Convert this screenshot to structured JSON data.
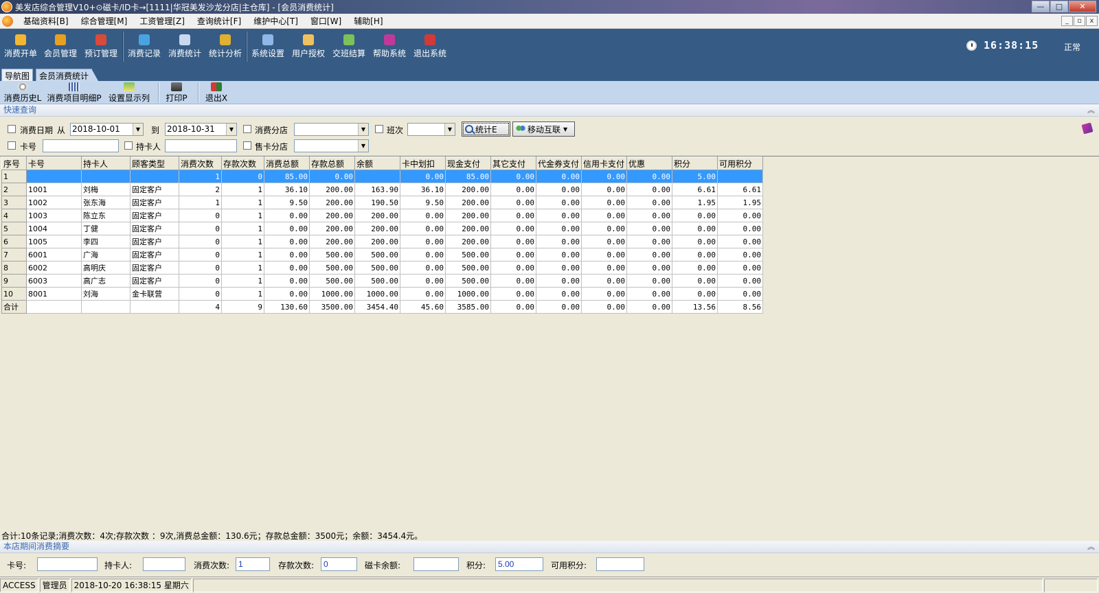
{
  "window": {
    "title": "美发店综合管理V10+⊙磁卡/ID卡→[1111|华冠美发沙龙分店|主仓库] - [会员消费统计]",
    "min_glyph": "—",
    "max_glyph": "□",
    "close_glyph": "✕"
  },
  "menu": {
    "items": [
      "基础资料[B]",
      "综合管理[M]",
      "工资管理[Z]",
      "查询统计[F]",
      "维护中心[T]",
      "窗口[W]",
      "辅助[H]"
    ],
    "mdi_min": "_",
    "mdi_restore": "▫",
    "mdi_close": "x"
  },
  "toolbar": {
    "buttons": [
      {
        "label": "消费开单",
        "color": "#f2b632"
      },
      {
        "label": "会员管理",
        "color": "#e8a020"
      },
      {
        "label": "预订管理",
        "color": "#d94a3a"
      },
      {
        "label": "消费记录",
        "color": "#4aa3e0"
      },
      {
        "label": "消费统计",
        "color": "#c8d8f0"
      },
      {
        "label": "统计分析",
        "color": "#e0b030"
      },
      {
        "label": "系统设置",
        "color": "#8fb8e8"
      },
      {
        "label": "用户授权",
        "color": "#f0c060"
      },
      {
        "label": "交班结算",
        "color": "#7cc15a"
      },
      {
        "label": "帮助系统",
        "color": "#c0399a"
      },
      {
        "label": "退出系统",
        "color": "#d23a3a"
      }
    ],
    "clock": "16:38:15",
    "status": "正常"
  },
  "tabs": [
    "导航图",
    "会员消费统计"
  ],
  "subtoolbar": {
    "buttons": [
      "消费历史L",
      "消费项目明细P",
      "设置显示列",
      "打印P",
      "退出X"
    ]
  },
  "quick_query": {
    "header": "快速查询",
    "date_label": "消费日期",
    "from_label": "从",
    "date_from": "2018-10-01",
    "to_label": "到",
    "date_to": "2018-10-31",
    "branch_label": "消费分店",
    "branch_value": "",
    "shift_label": "班次",
    "shift_value": "",
    "stat_button": "统计E",
    "mobile_button": "移动互联",
    "card_label": "卡号",
    "card_value": "",
    "holder_label": "持卡人",
    "holder_value": "",
    "sale_branch_label": "售卡分店",
    "sale_branch_value": ""
  },
  "grid": {
    "columns": [
      "序号",
      "卡号",
      "持卡人",
      "顾客类型",
      "消费次数",
      "存款次数",
      "消费总额",
      "存款总额",
      "余额",
      "卡中划扣",
      "现金支付",
      "其它支付",
      "代金券支付",
      "信用卡支付",
      "优惠",
      "积分",
      "可用积分"
    ],
    "rows": [
      [
        "1",
        "",
        "",
        "",
        "1",
        "0",
        "85.00",
        "0.00",
        "",
        "0.00",
        "85.00",
        "0.00",
        "0.00",
        "0.00",
        "0.00",
        "5.00",
        ""
      ],
      [
        "2",
        "1001",
        "刘梅",
        "固定客户",
        "2",
        "1",
        "36.10",
        "200.00",
        "163.90",
        "36.10",
        "200.00",
        "0.00",
        "0.00",
        "0.00",
        "0.00",
        "6.61",
        "6.61"
      ],
      [
        "3",
        "1002",
        "张东海",
        "固定客户",
        "1",
        "1",
        "9.50",
        "200.00",
        "190.50",
        "9.50",
        "200.00",
        "0.00",
        "0.00",
        "0.00",
        "0.00",
        "1.95",
        "1.95"
      ],
      [
        "4",
        "1003",
        "陈立东",
        "固定客户",
        "0",
        "1",
        "0.00",
        "200.00",
        "200.00",
        "0.00",
        "200.00",
        "0.00",
        "0.00",
        "0.00",
        "0.00",
        "0.00",
        "0.00"
      ],
      [
        "5",
        "1004",
        "丁健",
        "固定客户",
        "0",
        "1",
        "0.00",
        "200.00",
        "200.00",
        "0.00",
        "200.00",
        "0.00",
        "0.00",
        "0.00",
        "0.00",
        "0.00",
        "0.00"
      ],
      [
        "6",
        "1005",
        "李四",
        "固定客户",
        "0",
        "1",
        "0.00",
        "200.00",
        "200.00",
        "0.00",
        "200.00",
        "0.00",
        "0.00",
        "0.00",
        "0.00",
        "0.00",
        "0.00"
      ],
      [
        "7",
        "6001",
        "广海",
        "固定客户",
        "0",
        "1",
        "0.00",
        "500.00",
        "500.00",
        "0.00",
        "500.00",
        "0.00",
        "0.00",
        "0.00",
        "0.00",
        "0.00",
        "0.00"
      ],
      [
        "8",
        "6002",
        "高明庆",
        "固定客户",
        "0",
        "1",
        "0.00",
        "500.00",
        "500.00",
        "0.00",
        "500.00",
        "0.00",
        "0.00",
        "0.00",
        "0.00",
        "0.00",
        "0.00"
      ],
      [
        "9",
        "6003",
        "高广志",
        "固定客户",
        "0",
        "1",
        "0.00",
        "500.00",
        "500.00",
        "0.00",
        "500.00",
        "0.00",
        "0.00",
        "0.00",
        "0.00",
        "0.00",
        "0.00"
      ],
      [
        "10",
        "8001",
        "刘海",
        "金卡联营",
        "0",
        "1",
        "0.00",
        "1000.00",
        "1000.00",
        "0.00",
        "1000.00",
        "0.00",
        "0.00",
        "0.00",
        "0.00",
        "0.00",
        "0.00"
      ]
    ],
    "total": [
      "合计",
      "",
      "",
      "",
      "4",
      "9",
      "130.60",
      "3500.00",
      "3454.40",
      "45.60",
      "3585.00",
      "0.00",
      "0.00",
      "0.00",
      "0.00",
      "13.56",
      "8.56"
    ],
    "selected_row": 0
  },
  "summary_line": "合计:10条记录;消费次数：4次;存款次数 ：9次,消费总金额：130.6元；存款总金额：3500元；余额：3454.4元。",
  "period_summary": {
    "header": "本店期间消费摘要",
    "card_label": "卡号:",
    "card_value": "",
    "holder_label": "持卡人:",
    "holder_value": "",
    "consume_label": "消费次数:",
    "consume_value": "1",
    "deposit_label": "存款次数:",
    "deposit_value": "0",
    "balance_label": "磁卡余额:",
    "balance_value": "",
    "points_label": "积分:",
    "points_value": "5.00",
    "avail_label": "可用积分:",
    "avail_value": ""
  },
  "statusbar": {
    "db": "ACCESS",
    "user": "管理员",
    "datetime": "2018-10-20 16:38:15 星期六"
  }
}
